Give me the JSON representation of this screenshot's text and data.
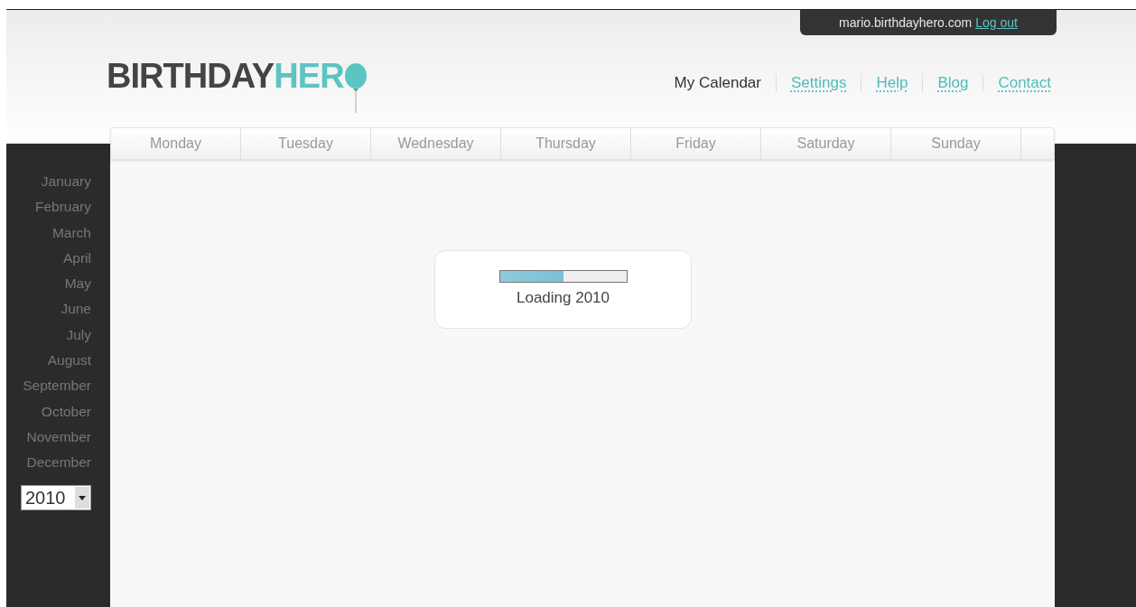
{
  "account": {
    "domain": "mario.birthdayhero.com",
    "logout": "Log out"
  },
  "logo": {
    "first": "BIRTHDAY",
    "second": "HER"
  },
  "nav": [
    {
      "label": "My Calendar",
      "selected": true
    },
    {
      "label": "Settings",
      "selected": false
    },
    {
      "label": "Help",
      "selected": false
    },
    {
      "label": "Blog",
      "selected": false
    },
    {
      "label": "Contact",
      "selected": false
    }
  ],
  "weekdays": [
    "Monday",
    "Tuesday",
    "Wednesday",
    "Thursday",
    "Friday",
    "Saturday",
    "Sunday"
  ],
  "months": [
    "January",
    "February",
    "March",
    "April",
    "May",
    "June",
    "July",
    "August",
    "September",
    "October",
    "November",
    "December"
  ],
  "year_select": {
    "value": "2010"
  },
  "loading": {
    "level": 0.5,
    "label": "Loading 2010"
  }
}
